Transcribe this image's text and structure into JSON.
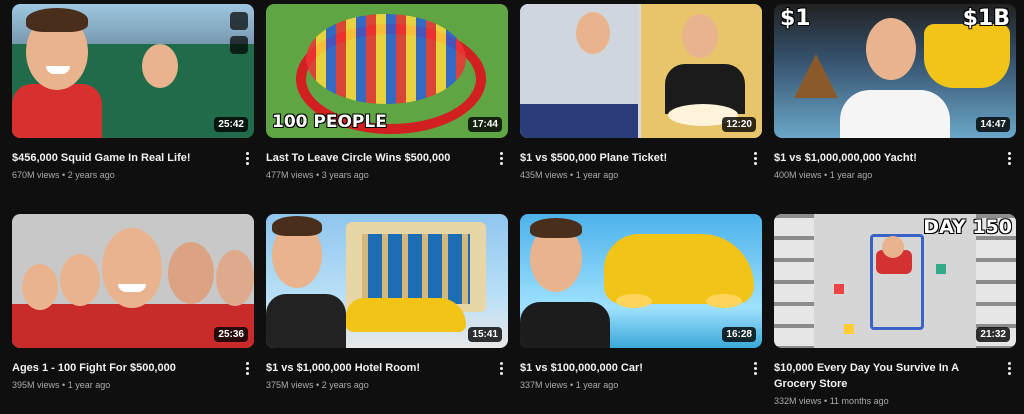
{
  "colors": {
    "background": "#0f0f0f",
    "title": "#f1f1f1",
    "meta": "#aaaaaa"
  },
  "videos": [
    {
      "title": "$456,000 Squid Game In Real Life!",
      "views": "670M views",
      "age": "2 years ago",
      "duration": "25:42",
      "thumb_text": ""
    },
    {
      "title": "Last To Leave Circle Wins $500,000",
      "views": "477M views",
      "age": "3 years ago",
      "duration": "17:44",
      "thumb_text": "100 PEOPLE"
    },
    {
      "title": "$1 vs $500,000 Plane Ticket!",
      "views": "435M views",
      "age": "1 year ago",
      "duration": "12:20",
      "thumb_text": ""
    },
    {
      "title": "$1 vs $1,000,000,000 Yacht!",
      "views": "400M views",
      "age": "1 year ago",
      "duration": "14:47",
      "thumb_text_left": "$1",
      "thumb_text_right": "$1B"
    },
    {
      "title": "Ages 1 - 100 Fight For $500,000",
      "views": "395M views",
      "age": "1 year ago",
      "duration": "25:36",
      "thumb_text": ""
    },
    {
      "title": "$1 vs $1,000,000 Hotel Room!",
      "views": "375M views",
      "age": "2 years ago",
      "duration": "15:41",
      "thumb_text": ""
    },
    {
      "title": "$1 vs $100,000,000 Car!",
      "views": "337M views",
      "age": "1 year ago",
      "duration": "16:28",
      "thumb_text": ""
    },
    {
      "title": "$10,000 Every Day You Survive In A Grocery Store",
      "views": "332M views",
      "age": "11 months ago",
      "duration": "21:32",
      "thumb_text": "DAY 150"
    }
  ],
  "separator": "•"
}
